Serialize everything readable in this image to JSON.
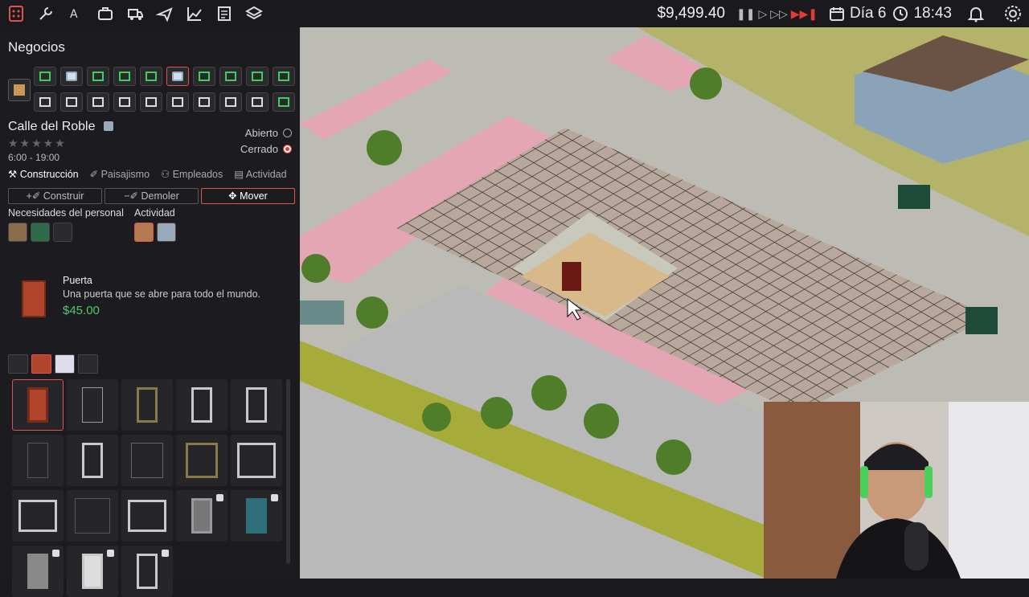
{
  "topbar": {
    "icons": [
      "business-icon",
      "tools-icon",
      "text-icon",
      "briefcase-icon",
      "delivery-icon",
      "plane-icon",
      "chart-icon",
      "ledger-icon",
      "layers-icon"
    ],
    "money": "$9,499.40",
    "day": "Día 6",
    "time": "18:43"
  },
  "panel": {
    "title": "Negocios",
    "street": "Calle del Roble",
    "hours": "6:00 - 19:00",
    "open_label": "Abierto",
    "closed_label": "Cerrado",
    "tabs": [
      "Construcción",
      "Paisajismo",
      "Empleados",
      "Actividad"
    ],
    "actions": [
      "+✐ Construir",
      "−✐ Demoler",
      "✥ Mover"
    ],
    "needs_label": "Necesidades del personal",
    "activity_label": "Actividad",
    "item": {
      "name": "Puerta",
      "description": "Una puerta que se abre para todo el mundo.",
      "price": "$45.00"
    }
  },
  "colors": {
    "accent_red": "#e0524e",
    "money_green": "#4fc96a"
  }
}
